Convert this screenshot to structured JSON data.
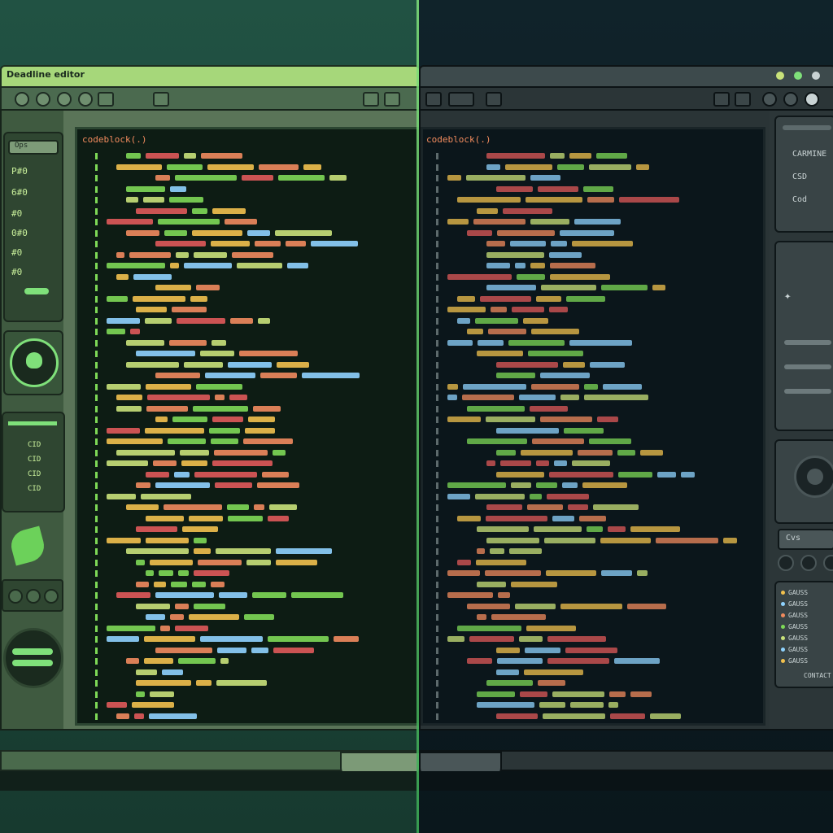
{
  "window": {
    "title": "Deadline editor"
  },
  "colors": {
    "light_frame": "#a6d77a",
    "dark_frame": "#3d4a4c",
    "accent_green": "#7fe07a",
    "syntax": [
      "#f2c14e",
      "#7ed957",
      "#f18b5e",
      "#e05a5a",
      "#8fd3ff",
      "#c9e27a"
    ]
  },
  "left_sidebar": {
    "search_label": "Ops",
    "items": [
      "P#0",
      "6#0",
      "#0",
      "0#0",
      "#0",
      "#0"
    ],
    "list_items": [
      "CID",
      "CID",
      "CID",
      "CID"
    ]
  },
  "right_sidebar": {
    "items": [
      "CARMINE",
      "CSD",
      "Cod",
      "Cvs"
    ],
    "list_items": [
      "GAUSS",
      "GAUSS",
      "GAUSS",
      "GAUSS",
      "GAUSS",
      "GAUSS",
      "GAUSS"
    ],
    "footer_label": "CONTACT"
  },
  "editor_left": {
    "header": "codeblock(.)"
  },
  "editor_right": {
    "header": "codeblock(.)"
  }
}
